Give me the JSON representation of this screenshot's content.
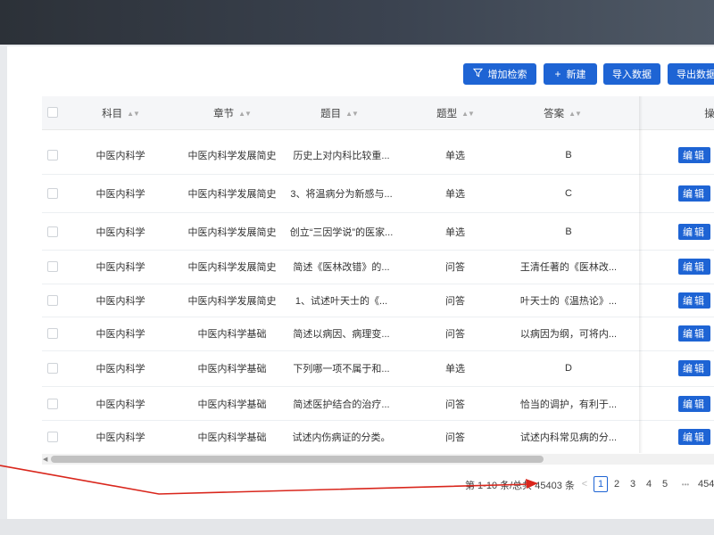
{
  "toolbar": {
    "filter_label": "增加检索",
    "add_label": "新建",
    "import_label": "导入数据",
    "export_label": "导出数据"
  },
  "table": {
    "columns": [
      "科目",
      "章节",
      "题目",
      "题型",
      "答案",
      "操"
    ],
    "action_label": "编辑",
    "rows": [
      {
        "subject": "中医内科学",
        "chapter": "中医内科学发展简史",
        "question": "历史上对内科比较重...",
        "type": "单选",
        "answer": "B"
      },
      {
        "subject": "中医内科学",
        "chapter": "中医内科学发展简史",
        "question": "3、将温病分为新感与...",
        "type": "单选",
        "answer": "C"
      },
      {
        "subject": "中医内科学",
        "chapter": "中医内科学发展简史",
        "question": "创立“三因学说”的医家...",
        "type": "单选",
        "answer": "B"
      },
      {
        "subject": "中医内科学",
        "chapter": "中医内科学发展简史",
        "question": "简述《医林改错》的...",
        "type": "问答",
        "answer": "王清任著的《医林改..."
      },
      {
        "subject": "中医内科学",
        "chapter": "中医内科学发展简史",
        "question": "1、试述叶天士的《...",
        "type": "问答",
        "answer": "叶天士的《温热论》..."
      },
      {
        "subject": "中医内科学",
        "chapter": "中医内科学基础",
        "question": "简述以病因、病理变...",
        "type": "问答",
        "answer": "以病因为纲，可将内..."
      },
      {
        "subject": "中医内科学",
        "chapter": "中医内科学基础",
        "question": "下列哪一项不属于和...",
        "type": "单选",
        "answer": "D"
      },
      {
        "subject": "中医内科学",
        "chapter": "中医内科学基础",
        "question": "简述医护结合的治疗...",
        "type": "问答",
        "answer": "恰当的调护，有利于..."
      },
      {
        "subject": "中医内科学",
        "chapter": "中医内科学基础",
        "question": "试述内伤病证的分类。",
        "type": "问答",
        "answer": "试述内科常见病的分..."
      }
    ]
  },
  "pagination": {
    "summary": "第 1-10 条/总共 45403 条",
    "prev": "<",
    "pages": [
      "1",
      "2",
      "3",
      "4",
      "5"
    ],
    "ellipsis": "•••",
    "last": "454"
  },
  "colors": {
    "primary": "#1e64d4",
    "annotation_arrow": "#d9261c",
    "topbar": "#2c3138"
  }
}
